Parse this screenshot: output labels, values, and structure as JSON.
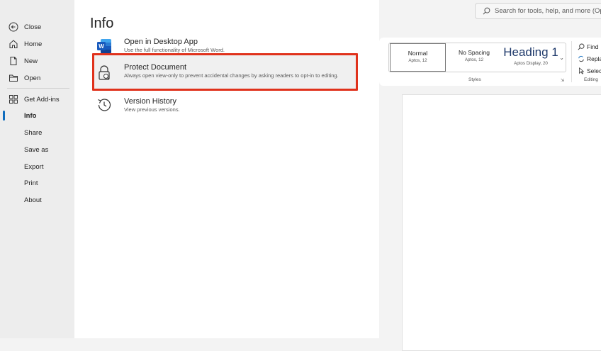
{
  "search": {
    "placeholder": "Search for tools, help, and more (Op"
  },
  "ribbon": {
    "styles": [
      {
        "name": "Normal",
        "font": "Aptos, 12"
      },
      {
        "name": "No Spacing",
        "font": "Aptos, 12"
      },
      {
        "name": "Heading 1",
        "font": "Aptos Display, 20"
      }
    ],
    "styles_group_label": "Styles",
    "editing": {
      "find": "Find",
      "replace": "Repla",
      "select": "Selec",
      "group_label": "Editing"
    }
  },
  "nav": {
    "items": [
      {
        "label": "Close",
        "icon": "back-arrow-icon"
      },
      {
        "label": "Home",
        "icon": "home-icon"
      },
      {
        "label": "New",
        "icon": "new-document-icon"
      },
      {
        "label": "Open",
        "icon": "folder-icon"
      },
      {
        "label": "Get Add-ins",
        "icon": "add-ins-icon"
      },
      {
        "label": "Info",
        "icon": "",
        "active": true
      },
      {
        "label": "Share"
      },
      {
        "label": "Save as"
      },
      {
        "label": "Export"
      },
      {
        "label": "Print"
      },
      {
        "label": "About"
      }
    ]
  },
  "info": {
    "title": "Info",
    "items": [
      {
        "title": "Open in Desktop App",
        "desc": "Use the full functionality of Microsoft Word.",
        "icon": "word-app-icon"
      },
      {
        "title": "Protect Document",
        "desc": "Always open view-only to prevent accidental changes by asking readers to opt-in to editing.",
        "icon": "lock-icon"
      },
      {
        "title": "Version History",
        "desc": "View previous versions.",
        "icon": "history-icon"
      }
    ]
  },
  "colors": {
    "highlight": "#e0321c",
    "accent": "#0f6cbd",
    "word_blue": "#185abd"
  }
}
